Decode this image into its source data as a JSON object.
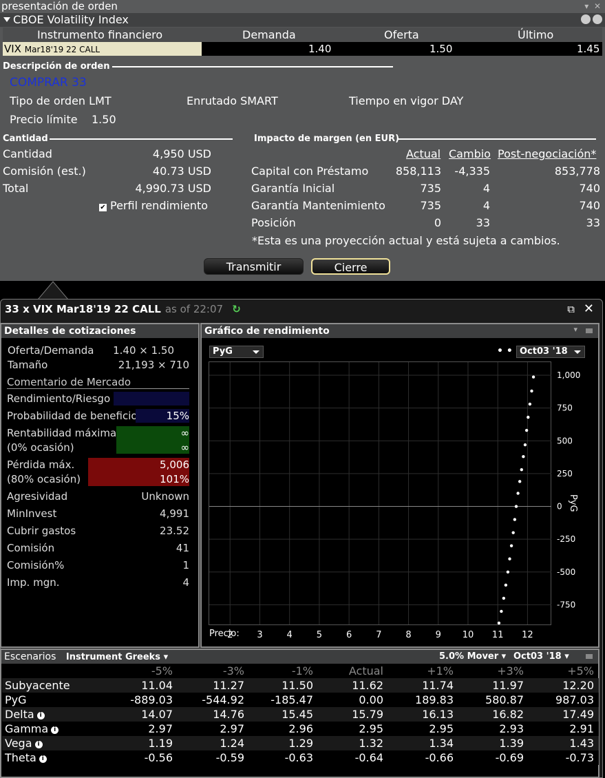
{
  "window_title": "presentación de orden",
  "instrument_header": "CBOE Volatility Index",
  "quote_table": {
    "headers": [
      "Instrumento financiero",
      "Demanda",
      "Oferta",
      "Último"
    ],
    "row": {
      "name_main": "VIX",
      "name_sub": "Mar18'19 22 CALL",
      "bid": "1.40",
      "ask": "1.50",
      "last": "1.45"
    }
  },
  "order_desc": {
    "section": "Descripción de orden",
    "action": "COMPRAR 33",
    "order_type": "Tipo de orden LMT",
    "routing": "Enrutado SMART",
    "tif": "Tiempo en vigor DAY",
    "limit_label": "Precio límite",
    "limit_value": "1.50"
  },
  "quantity": {
    "section": "Cantidad",
    "rows": [
      {
        "label": "Cantidad",
        "value": "4,950 USD"
      },
      {
        "label": "Comisión (est.)",
        "value": "40.73 USD"
      },
      {
        "label": "Total",
        "value": "4,990.73 USD"
      }
    ],
    "profile_label": "Perfil rendimiento",
    "profile_checked": "✔"
  },
  "margin": {
    "section": "Impacto de margen (en EUR)",
    "headers": [
      "Actual",
      "Cambio",
      "Post-negociación*"
    ],
    "rows": [
      {
        "label": "Capital con Préstamo",
        "actual": "858,113",
        "change": "-4,335",
        "post": "853,778"
      },
      {
        "label": "Garantía Inicial",
        "actual": "735",
        "change": "4",
        "post": "740"
      },
      {
        "label": "Garantía Mantenimiento",
        "actual": "735",
        "change": "4",
        "post": "740"
      },
      {
        "label": "Posición",
        "actual": "0",
        "change": "33",
        "post": "33"
      }
    ],
    "footnote": "*Esta es una proyección actual y está sujeta a cambios."
  },
  "buttons": {
    "transmit": "Transmitir",
    "close": "Cierre"
  },
  "panel": {
    "title": "33 x VIX Mar18'19 22 CALL",
    "as_of": "as of 22:07"
  },
  "details": {
    "header": "Detalles de cotizaciones",
    "bid_ask_label": "Oferta/Demanda",
    "bid_ask_value": "1.40 × 1.50",
    "size_label": "Tamaño",
    "size_value": "21,193 × 710",
    "comment": "Comentario de Mercado",
    "risk_label": "Rendimiento/Riesgo",
    "prob_label": "Probabilidad de beneficio",
    "prob_value": "15%",
    "max_return_label": "Rentabilidad máxima",
    "max_return_value": "∞",
    "max_return_sub": "(0% ocasión)",
    "max_return_sub_value": "∞",
    "max_loss_label": "Pérdida máx.",
    "max_loss_value": "5,006",
    "max_loss_sub": "(80% ocasión)",
    "max_loss_sub_value": "101%",
    "rows": [
      {
        "label": "Agresividad",
        "value": "Unknown"
      },
      {
        "label": "MinInvest",
        "value": "4,991"
      },
      {
        "label": "Cubrir gastos",
        "value": "23.52"
      },
      {
        "label": "Comisión",
        "value": "41"
      },
      {
        "label": "Comisión%",
        "value": "1"
      },
      {
        "label": "Imp. mgn.",
        "value": "4"
      }
    ],
    "colors": {
      "risk": "#0a0a3a",
      "prob": "#0a0a3a",
      "max_return": "#0b4a0b",
      "max_loss": "#7a0a0a"
    }
  },
  "chart_panel": {
    "header": "Gráfico de rendimiento",
    "dropdown": "PyG",
    "date_dropdown": "Oct03 '18",
    "xlabel_prefix": "Precio:"
  },
  "chart_data": {
    "type": "scatter",
    "ylabel": "PyG",
    "x_ticks": [
      "2",
      "3",
      "4",
      "5",
      "6",
      "7",
      "8",
      "9",
      "10",
      "11",
      "12"
    ],
    "y_ticks": [
      "1,000",
      "750",
      "500",
      "250",
      "0",
      "-250",
      "-500",
      "-750"
    ],
    "xlim": [
      1.3,
      12.8
    ],
    "ylim": [
      -900,
      1100
    ],
    "points": [
      [
        11.04,
        -889
      ],
      [
        11.12,
        -800
      ],
      [
        11.2,
        -700
      ],
      [
        11.27,
        -600
      ],
      [
        11.34,
        -500
      ],
      [
        11.4,
        -400
      ],
      [
        11.46,
        -300
      ],
      [
        11.52,
        -200
      ],
      [
        11.57,
        -100
      ],
      [
        11.62,
        0
      ],
      [
        11.68,
        100
      ],
      [
        11.74,
        190
      ],
      [
        11.8,
        280
      ],
      [
        11.86,
        380
      ],
      [
        11.92,
        470
      ],
      [
        11.97,
        580
      ],
      [
        12.02,
        680
      ],
      [
        12.08,
        780
      ],
      [
        12.14,
        880
      ],
      [
        12.2,
        987
      ]
    ]
  },
  "scenarios": {
    "header": "Escenarios",
    "dropdown": "Instrument Greeks",
    "mover": "5.0% Mover",
    "date": "Oct03 '18",
    "columns": [
      "-5%",
      "-3%",
      "-1%",
      "Actual",
      "+1%",
      "+3%",
      "+5%"
    ],
    "rows": [
      {
        "label": "Subyacente",
        "values": [
          "11.04",
          "11.27",
          "11.50",
          "11.62",
          "11.74",
          "11.97",
          "12.20"
        ]
      },
      {
        "label": "PyG",
        "values": [
          "-889.03",
          "-544.92",
          "-185.47",
          "0.00",
          "189.83",
          "580.87",
          "987.03"
        ]
      },
      {
        "label": "Delta",
        "values": [
          "14.07",
          "14.76",
          "15.45",
          "15.79",
          "16.13",
          "16.82",
          "17.49"
        ]
      },
      {
        "label": "Gamma",
        "values": [
          "2.97",
          "2.97",
          "2.96",
          "2.95",
          "2.95",
          "2.93",
          "2.91"
        ]
      },
      {
        "label": "Vega",
        "values": [
          "1.19",
          "1.24",
          "1.29",
          "1.32",
          "1.34",
          "1.39",
          "1.43"
        ]
      },
      {
        "label": "Theta",
        "values": [
          "-0.56",
          "-0.59",
          "-0.63",
          "-0.64",
          "-0.66",
          "-0.69",
          "-0.73"
        ]
      }
    ]
  }
}
